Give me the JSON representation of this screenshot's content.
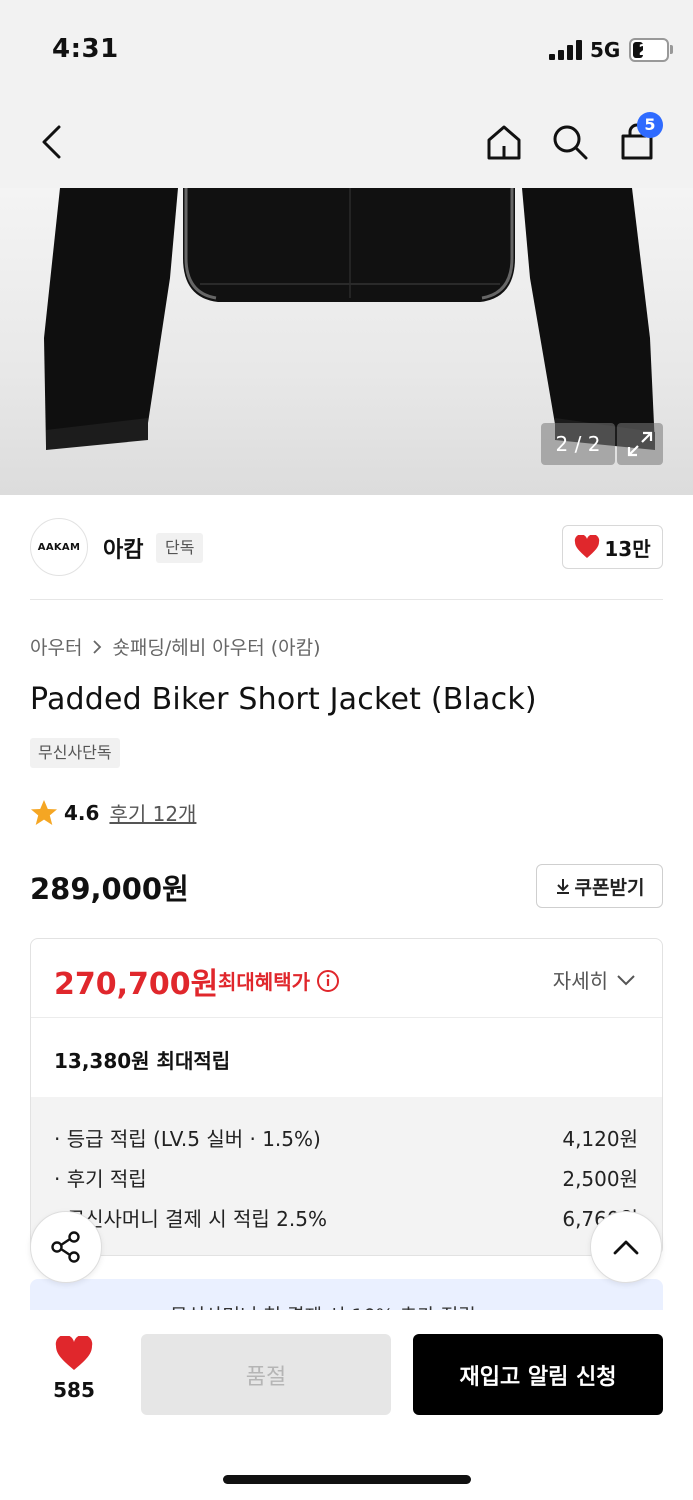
{
  "status_bar": {
    "time": "4:31",
    "network": "5G",
    "battery": "21"
  },
  "nav": {
    "cart_count": "5",
    "icons": [
      "back-chevron-icon",
      "home-icon",
      "search-icon",
      "shopping-bag-icon"
    ]
  },
  "gallery": {
    "counter": "2 / 2",
    "current_image": 2,
    "total_images": 2
  },
  "brand": {
    "logo_text": "AAKAM",
    "name": "아캄",
    "badge": "단독",
    "like_count": "13만"
  },
  "breadcrumb": {
    "category": "아우터",
    "subcategory": "숏패딩/헤비 아우터 (아캄)"
  },
  "product": {
    "title": "Padded Biker Short Jacket (Black)",
    "tag": "무신사단독",
    "rating": "4.6",
    "review_link": "후기 12개",
    "price": "289,000원",
    "coupon_button": "쿠폰받기"
  },
  "benefit": {
    "max_benefit_price": "270,700원",
    "max_benefit_label": "최대혜택가",
    "detail_toggle": "자세히",
    "points_summary": "13,380원 최대적립",
    "points": [
      {
        "label": "· 등급 적립 (LV.5 실버 · 1.5%)",
        "amount": "4,120원"
      },
      {
        "label": "· 후기 적립",
        "amount": "2,500원"
      },
      {
        "label": "· 무신사머니 결제 시 적립 2.5%",
        "amount": "6,760원"
      }
    ]
  },
  "promo": {
    "text": "무신사머니 첫 결제 시 10% 추가 적립"
  },
  "bottom_bar": {
    "wish_count": "585",
    "soldout_label": "품절",
    "restock_label": "재입고 알림 신청"
  },
  "colors": {
    "accent_red": "#e0272c",
    "badge_blue": "#2f6bff",
    "primary_black": "#000000"
  }
}
